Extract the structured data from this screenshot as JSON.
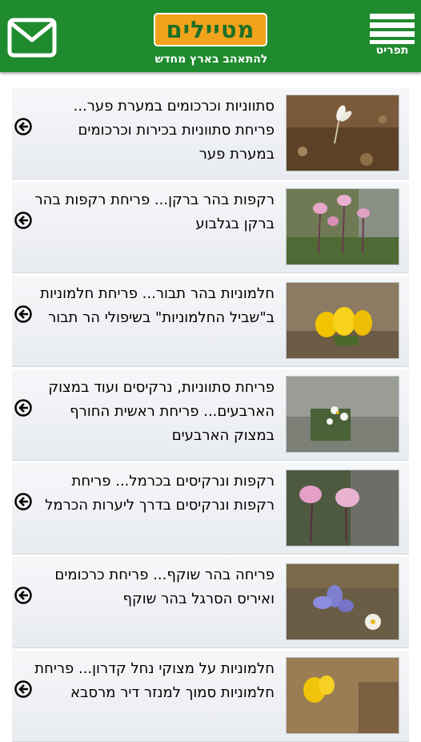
{
  "header": {
    "logo_text": "מטיילים",
    "logo_tagline": "להתאהב בארץ מחדש",
    "menu_label": "תפריט",
    "colors": {
      "bar": "#1f8a2e",
      "logo_bg": "#f2a31b",
      "logo_text": "#1f6f27"
    }
  },
  "items": [
    {
      "text": "סתווניות וכרכומים במערת פער... פריחת סתווניות בכירות וכרכומים במערת פער",
      "thumb": "white crocus on brown soil"
    },
    {
      "text": "רקפות בהר ברקן... פריחת רקפות בהר ברקן בגלבוע",
      "thumb": "pink cyclamen among rocks"
    },
    {
      "text": "חלמוניות בהר תבור... פריחת חלמוניות ב\"שביל החלמוניות\" בשיפולי הר תבור",
      "thumb": "yellow sternbergia flowers"
    },
    {
      "text": "פריחת סתווניות, נרקיסים ועוד במצוק הארבעים... פריחת ראשית החורף במצוק הארבעים",
      "thumb": "white narcissus among rocks"
    },
    {
      "text": "רקפות ונרקיסים בכרמל... פריחת רקפות ונרקיסים בדרך ליערות הכרמל",
      "thumb": "pink cyclamen flowers"
    },
    {
      "text": "פריחה בהר שוקף... פריחת כרכומים ואיריס הסרגל בהר שוקף",
      "thumb": "blue iris and white crocus"
    },
    {
      "text": "חלמוניות על מצוקי נחל קדרון... פריחת חלמוניות סמוך למנזר דיר מרסבא",
      "thumb": "yellow sternbergia on cliff"
    }
  ],
  "icons": {
    "mail": "envelope-icon",
    "menu": "hamburger-icon",
    "item_arrow": "circle-arrow-left-icon"
  }
}
